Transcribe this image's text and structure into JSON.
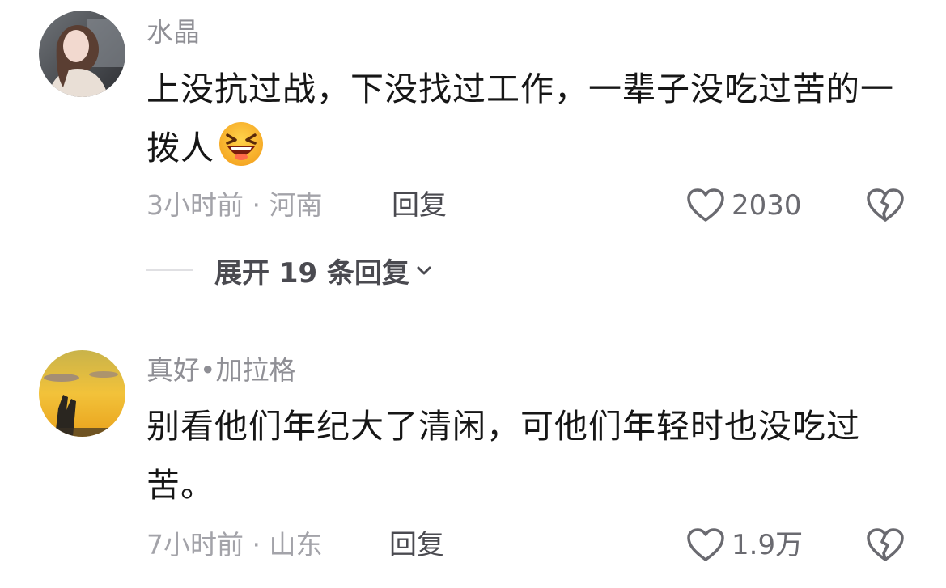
{
  "comments": [
    {
      "username": "水晶",
      "text": "上没抗过战，下没找过工作，一辈子没吃过苦的一拨人",
      "emoji": "laughing-face-emoji",
      "time": "3小时前",
      "separator": "·",
      "location": "河南",
      "reply_label": "回复",
      "likes": "2030",
      "expand_label": "展开 19 条回复"
    },
    {
      "username": "真好•加拉格",
      "text": "别看他们年纪大了清闲，可他们年轻时也没吃过苦。",
      "time": "7小时前",
      "separator": "·",
      "location": "山东",
      "reply_label": "回复",
      "likes": "1.9万"
    }
  ],
  "colors": {
    "text": "#161616",
    "secondary": "#8f8f95",
    "icon": "#6a6a70"
  },
  "icons": {
    "like": "heart-outline-icon",
    "dislike": "broken-heart-icon",
    "expand": "chevron-down-icon"
  }
}
